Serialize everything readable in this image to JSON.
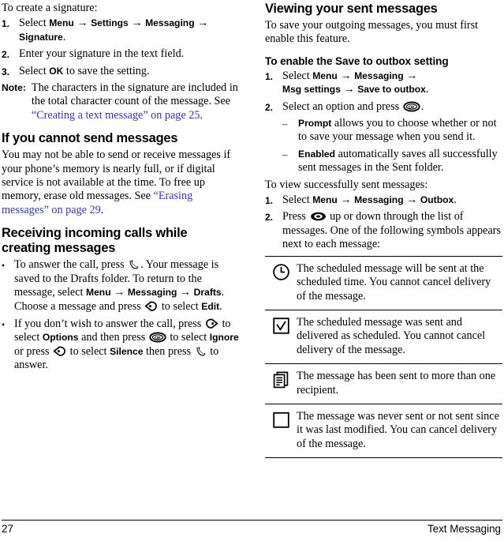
{
  "document": {
    "type": "user-manual-page",
    "page_number": "27",
    "footer_section": "Text Messaging",
    "link_color": "#3333cc"
  },
  "left_column": {
    "intro_line": "To create a signature:",
    "signature_steps": [
      {
        "num": "1.",
        "prefix": "Select ",
        "path": [
          "Menu",
          "Settings",
          "Messaging",
          "Signature"
        ],
        "suffix": "."
      },
      {
        "num": "2.",
        "text": "Enter your signature in the text field."
      },
      {
        "num": "3.",
        "prefix": "Select ",
        "key": "OK",
        "suffix": " to save the setting."
      }
    ],
    "note": {
      "label": "Note:",
      "text_before": "The characters in the signature are included in the total character count of the message. See ",
      "xref": "“Creating a text message” on page 25",
      "text_after": "."
    },
    "heading_cannot_send": "If you cannot send messages",
    "cannot_send_body_before": "You may not be able to send or receive messages if your phone’s memory is nearly full, or if digital service is not available at the time. To free up memory, erase old messages. See ",
    "cannot_send_xref": "“Erasing messages” on page 29",
    "cannot_send_body_after": ".",
    "heading_receiving": "Receiving incoming calls while creating messages",
    "bullets": [
      {
        "dot": "•",
        "segments": [
          {
            "kind": "text",
            "value": "To answer the call, press "
          },
          {
            "kind": "icon",
            "value": "send-key-icon"
          },
          {
            "kind": "text",
            "value": ". Your message is saved to the Drafts folder. To return to the message, select "
          },
          {
            "kind": "ui",
            "value": "Menu"
          },
          {
            "kind": "arrow",
            "value": "→"
          },
          {
            "kind": "ui",
            "value": "Messaging"
          },
          {
            "kind": "arrow",
            "value": "→"
          },
          {
            "kind": "ui",
            "value": "Drafts"
          },
          {
            "kind": "text",
            "value": ". Choose a message and press "
          },
          {
            "kind": "icon",
            "value": "right-soft-key-icon"
          },
          {
            "kind": "text",
            "value": " to select "
          },
          {
            "kind": "ui",
            "value": "Edit"
          },
          {
            "kind": "text",
            "value": "."
          }
        ]
      },
      {
        "dot": "•",
        "segments": [
          {
            "kind": "text",
            "value": "If you don’t wish to answer the call, press "
          },
          {
            "kind": "icon",
            "value": "left-soft-key-icon"
          },
          {
            "kind": "text",
            "value": " to select "
          },
          {
            "kind": "ui",
            "value": "Options"
          },
          {
            "kind": "text",
            "value": " and then press "
          },
          {
            "kind": "icon",
            "value": "ok-key-icon"
          },
          {
            "kind": "text",
            "value": " to select "
          },
          {
            "kind": "ui",
            "value": "Ignore"
          },
          {
            "kind": "text",
            "value": " or press "
          },
          {
            "kind": "icon",
            "value": "right-soft-key-icon"
          },
          {
            "kind": "text",
            "value": " to select "
          },
          {
            "kind": "ui",
            "value": "Silence"
          },
          {
            "kind": "text",
            "value": " then press "
          },
          {
            "kind": "icon",
            "value": "send-key-icon"
          },
          {
            "kind": "text",
            "value": " to answer."
          }
        ]
      }
    ]
  },
  "right_column": {
    "heading_viewing": "Viewing your sent messages",
    "viewing_intro": "To save your outgoing messages, you must first enable this feature.",
    "heading_enable": "To enable the Save to outbox setting",
    "enable_steps": [
      {
        "num": "1.",
        "prefix": "Select ",
        "path": [
          "Menu",
          "Messaging",
          "Msg settings",
          "Save to outbox"
        ],
        "suffix": "."
      },
      {
        "num": "2.",
        "prefix": "Select an option and press ",
        "key_icon": "ok-key-icon",
        "suffix": "."
      }
    ],
    "options": [
      {
        "mark": "–",
        "term": "Prompt",
        "desc": " allows you to choose whether or not to save your message when you send it."
      },
      {
        "mark": "–",
        "term": "Enabled",
        "desc": " automatically saves all successfully sent messages in the Sent folder."
      }
    ],
    "view_intro": "To view successfully sent messages:",
    "view_steps": [
      {
        "num": "1.",
        "prefix": "Select ",
        "path": [
          "Menu",
          "Messaging",
          "Outbox"
        ],
        "suffix": "."
      },
      {
        "num": "2.",
        "prefix": "Press ",
        "key_icon": "navigation-key-icon",
        "suffix": " up or down through the list of messages. One of the following symbols appears next to each message:"
      }
    ],
    "symbol_table": [
      {
        "icon": "clock-icon",
        "description": "The scheduled message will be sent at the scheduled time. You cannot cancel delivery of the message."
      },
      {
        "icon": "checkbox-checked-icon",
        "description": "The scheduled message was sent and delivered as scheduled. You cannot cancel delivery of the message."
      },
      {
        "icon": "multiple-pages-icon",
        "description": "The message has been sent to more than one recipient."
      },
      {
        "icon": "empty-box-icon",
        "description": "The message was never sent or not sent since it was last modified. You can cancel delivery of the message."
      }
    ]
  }
}
